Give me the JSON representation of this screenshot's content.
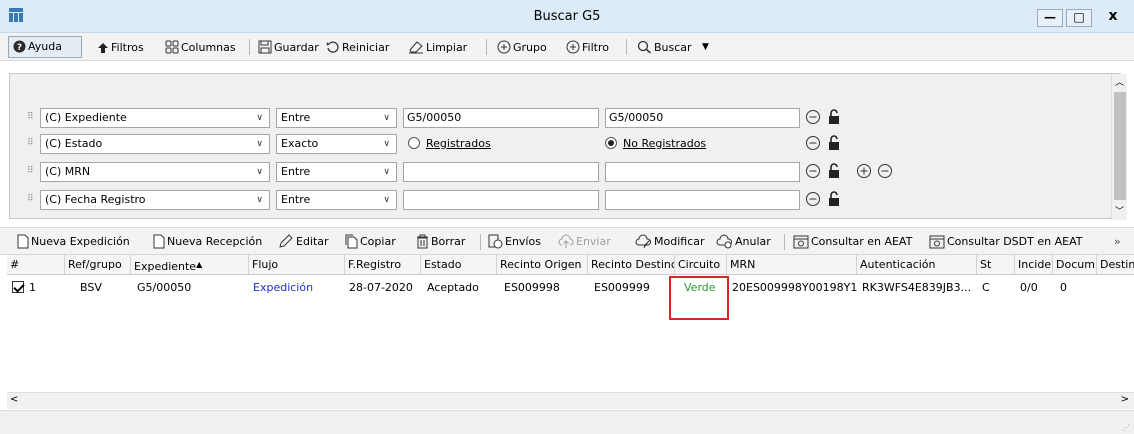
{
  "window": {
    "title": "Buscar G5",
    "minimize": "—",
    "maximize": "□",
    "close": "x"
  },
  "toolbar": {
    "ayuda": "Ayuda",
    "filtros": "Filtros",
    "columnas": "Columnas",
    "guardar": "Guardar",
    "reiniciar": "Reiniciar",
    "limpiar": "Limpiar",
    "grupo": "Grupo",
    "filtro": "Filtro",
    "buscar": "Buscar"
  },
  "filters": [
    {
      "field": "(C) Expediente",
      "operator": "Entre",
      "value1": "G5/00050",
      "value2": "G5/00050"
    },
    {
      "field": "(C) Estado",
      "operator": "Exacto",
      "radio1": "Registrados",
      "radio2": "No Registrados",
      "selected": "No Registrados"
    },
    {
      "field": "(C) MRN",
      "operator": "Entre",
      "value1": "",
      "value2": ""
    },
    {
      "field": "(C) Fecha Registro",
      "operator": "Entre",
      "value1": "",
      "value2": ""
    }
  ],
  "actions": {
    "nueva_expedicion": "Nueva Expedición",
    "nueva_recepcion": "Nueva Recepción",
    "editar": "Editar",
    "copiar": "Copiar",
    "borrar": "Borrar",
    "envios": "Envíos",
    "enviar": "Enviar",
    "modificar": "Modificar",
    "anular": "Anular",
    "consultar_aeat": "Consultar en AEAT",
    "consultar_dsdt": "Consultar DSDT en AEAT",
    "more": "»"
  },
  "grid": {
    "columns": [
      "#",
      "Ref/grupo",
      "Expediente",
      "Flujo",
      "F.Registro",
      "Estado",
      "Recinto Origen",
      "Recinto Destino",
      "Circuito",
      "MRN",
      "Autenticación",
      "St",
      "Incider",
      "Docum",
      "Destin"
    ],
    "rows": [
      {
        "num": "1",
        "ref": "BSV",
        "expediente": "G5/00050",
        "flujo": "Expedición",
        "fregistro": "28-07-2020",
        "estado": "Aceptado",
        "origen": "ES009998",
        "destino": "ES009999",
        "circuito": "Verde",
        "mrn": "20ES009998Y00198Y1",
        "autenticacion": "RK3WFS4E839JB3...",
        "st": "C",
        "incidencias": "0/0",
        "documentos": "0",
        "destin": ""
      }
    ]
  },
  "colors": {
    "accent_link": "#1a32c8",
    "verde": "#2a9a2a",
    "highlight": "#d9242a"
  }
}
